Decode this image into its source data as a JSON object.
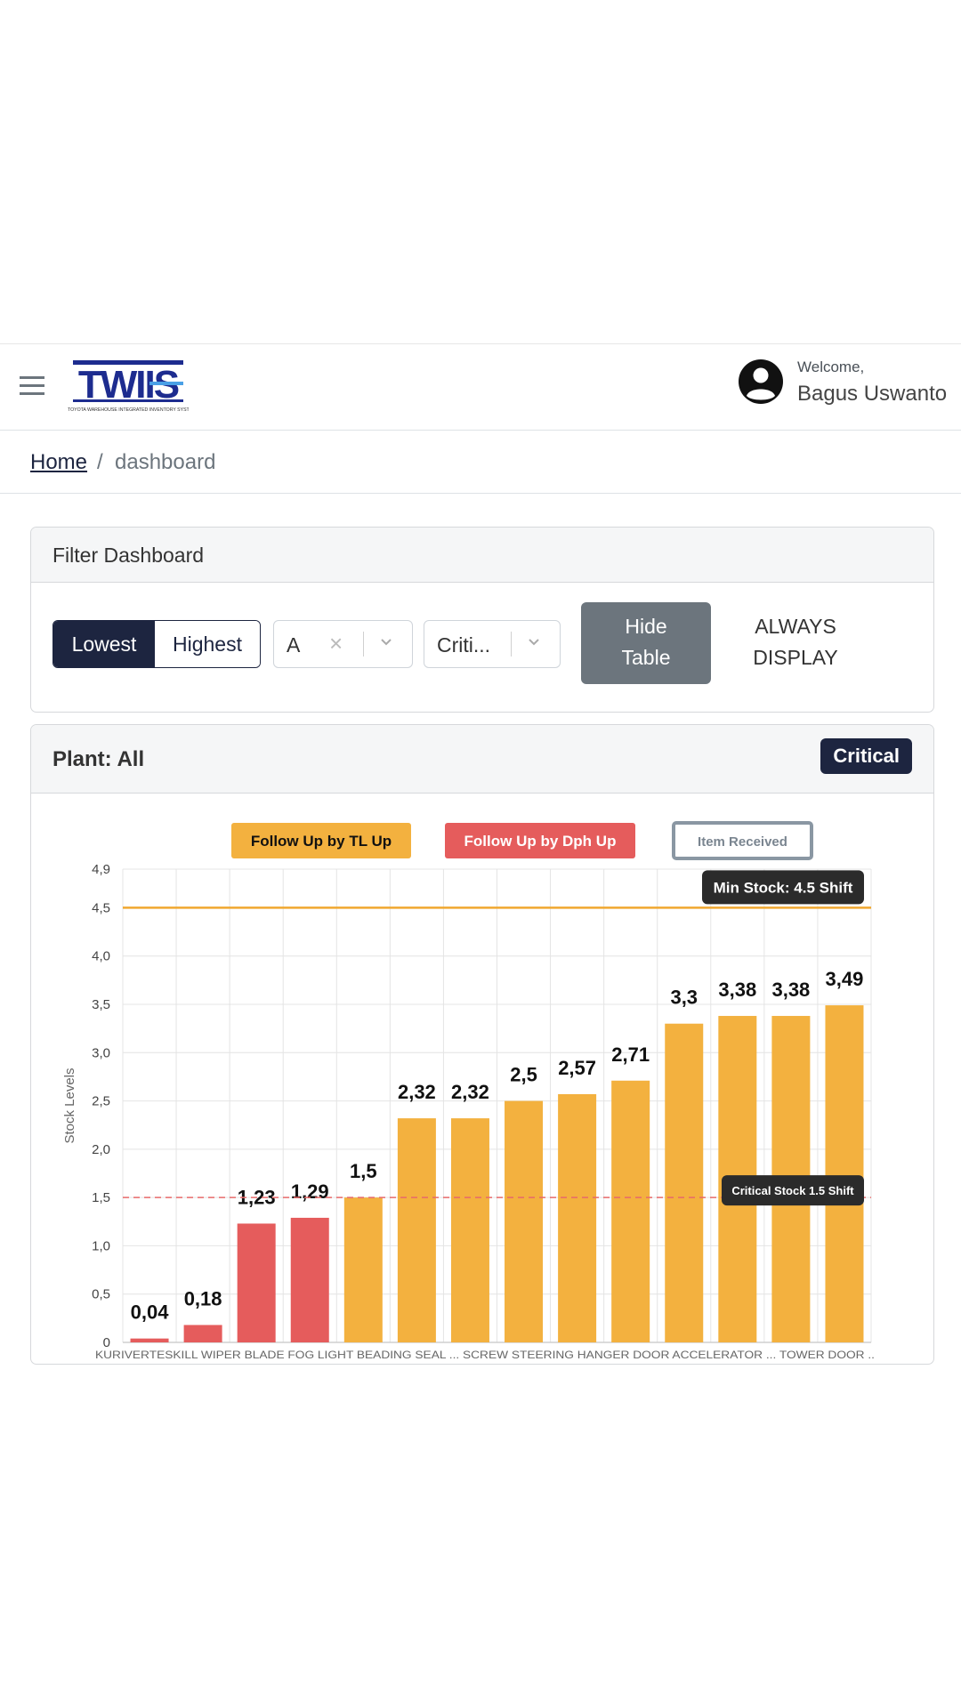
{
  "header": {
    "welcome": "Welcome,",
    "user_name": "Bagus Uswanto",
    "logo_text": "TWIIS",
    "logo_caption": "TOYOTA WAREHOUSE INTEGRATED INVENTORY SYSTEM"
  },
  "breadcrumb": {
    "home": "Home",
    "separator": "/",
    "current": "dashboard"
  },
  "filter": {
    "title": "Filter Dashboard",
    "sort_lowest": "Lowest",
    "sort_highest": "Highest",
    "sort_selected": "Lowest",
    "plant_value": "A",
    "status_value": "Criti...",
    "hide_table": "Hide Table",
    "always_display": "ALWAYS DISPLAY"
  },
  "chart_card": {
    "plant_label": "Plant: All",
    "badge": "Critical"
  },
  "colors": {
    "navy": "#1d2540",
    "amber": "#f3b13f",
    "red": "#e55c5c",
    "grey": "#6c757d"
  },
  "chart_data": {
    "type": "bar",
    "legend": [
      {
        "label": "Follow Up by TL Up",
        "color": "#f3b13f"
      },
      {
        "label": "Follow Up by Dph Up",
        "color": "#e55c5c"
      },
      {
        "label": "Item Received",
        "color": "#ffffff"
      }
    ],
    "ylabel": "Stock Levels",
    "ylim": [
      0,
      4.9
    ],
    "yticks": [
      "0",
      "0,5",
      "1,0",
      "1,5",
      "2,0",
      "2,5",
      "3,0",
      "3,5",
      "4,0",
      "4,5",
      "4,9"
    ],
    "ytick_values": [
      0,
      0.5,
      1.0,
      1.5,
      2.0,
      2.5,
      3.0,
      3.5,
      4.0,
      4.5,
      4.9
    ],
    "x_axis_text": "KURIVERTESKILL WIPER BLADE FOG LIGHT BEADING SEAL ... SCREW STEERING HANGER DOOR ACCELERATOR ... TOWER DOOR ..",
    "values": [
      0.04,
      0.18,
      1.23,
      1.29,
      1.5,
      2.32,
      2.32,
      2.5,
      2.57,
      2.71,
      3.3,
      3.38,
      3.38,
      3.49
    ],
    "value_labels": [
      "0,04",
      "0,18",
      "1,23",
      "1,29",
      "1,5",
      "2,32",
      "2,32",
      "2,5",
      "2,57",
      "2,71",
      "3,3",
      "3,38",
      "3,38",
      "3,49"
    ],
    "groups": [
      "dph",
      "dph",
      "dph",
      "dph",
      "tl",
      "tl",
      "tl",
      "tl",
      "tl",
      "tl",
      "tl",
      "tl",
      "tl",
      "tl"
    ],
    "min_stock": {
      "value": 4.5,
      "label": "Min Stock: 4.5 Shift"
    },
    "critical_stock": {
      "value": 1.5,
      "label": "Critical Stock 1.5 Shift"
    },
    "grid": true
  }
}
